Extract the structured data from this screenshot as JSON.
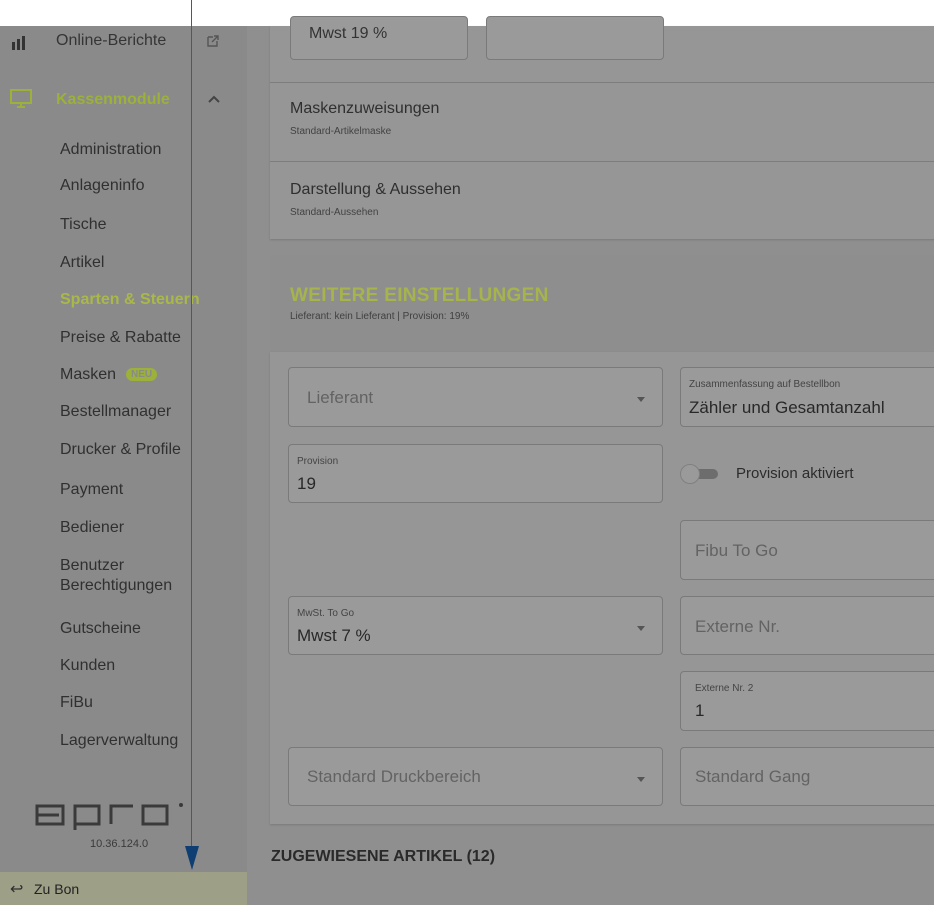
{
  "sidebar": {
    "top_item": {
      "label": "Online-Berichte",
      "icon": "bar-chart-icon",
      "ext_icon": "external-link-icon"
    },
    "group": {
      "label": "Kassenmodule",
      "icon": "monitor-icon",
      "chevron": "chevron-up-icon"
    },
    "items": [
      {
        "label": "Administration"
      },
      {
        "label": "Anlageninfo"
      },
      {
        "label": "Tische"
      },
      {
        "label": "Artikel"
      },
      {
        "label": "Sparten & Steuern",
        "active": true
      },
      {
        "label": "Preise & Rabatte"
      },
      {
        "label": "Masken",
        "badge": "NEU"
      },
      {
        "label": "Bestellmanager"
      },
      {
        "label": "Drucker & Profile"
      },
      {
        "label": "Payment"
      },
      {
        "label": "Bediener"
      },
      {
        "label": "Benutzer Berechtigungen",
        "line1": "Benutzer",
        "line2": "Berechtigungen"
      },
      {
        "label": "Gutscheine"
      },
      {
        "label": "Kunden"
      },
      {
        "label": "FiBu"
      },
      {
        "label": "Lagerverwaltung"
      }
    ],
    "logo_text": "apro",
    "version": "10.36.124.0",
    "back_label": "Zu Bon"
  },
  "main": {
    "top_fields": {
      "mwst": "Mwst 19 %"
    },
    "mask_assignments": {
      "title": "Maskenzuweisungen",
      "subtitle": "Standard-Artikelmaske"
    },
    "appearance": {
      "title": "Darstellung & Aussehen",
      "subtitle": "Standard-Aussehen"
    },
    "further_settings": {
      "title": "WEITERE EINSTELLUNGEN",
      "subtitle": "Lieferant: kein Lieferant | Provision: 19%"
    },
    "fields": {
      "lieferant": {
        "placeholder": "Lieferant"
      },
      "zusammenfassung": {
        "label": "Zusammenfassung auf Bestellbon",
        "value": "Zähler und Gesamtanzahl"
      },
      "provision": {
        "label": "Provision",
        "value": "19"
      },
      "provision_toggle": {
        "label": "Provision aktiviert",
        "checked": false
      },
      "fibu_to_go": {
        "placeholder": "Fibu To Go"
      },
      "mwst_to_go": {
        "label": "MwSt. To Go",
        "value": "Mwst 7 %"
      },
      "externe_nr": {
        "placeholder": "Externe Nr."
      },
      "externe_nr2": {
        "label": "Externe Nr. 2",
        "value": "1"
      },
      "druckbereich": {
        "placeholder": "Standard Druckbereich"
      },
      "gang": {
        "placeholder": "Standard Gang"
      }
    },
    "assigned_articles": "ZUGEWIESENE ARTIKEL (12)"
  },
  "colors": {
    "accent": "#9bb13a",
    "overlay": "#8f8f8f",
    "arrow": "#1f4f82"
  }
}
